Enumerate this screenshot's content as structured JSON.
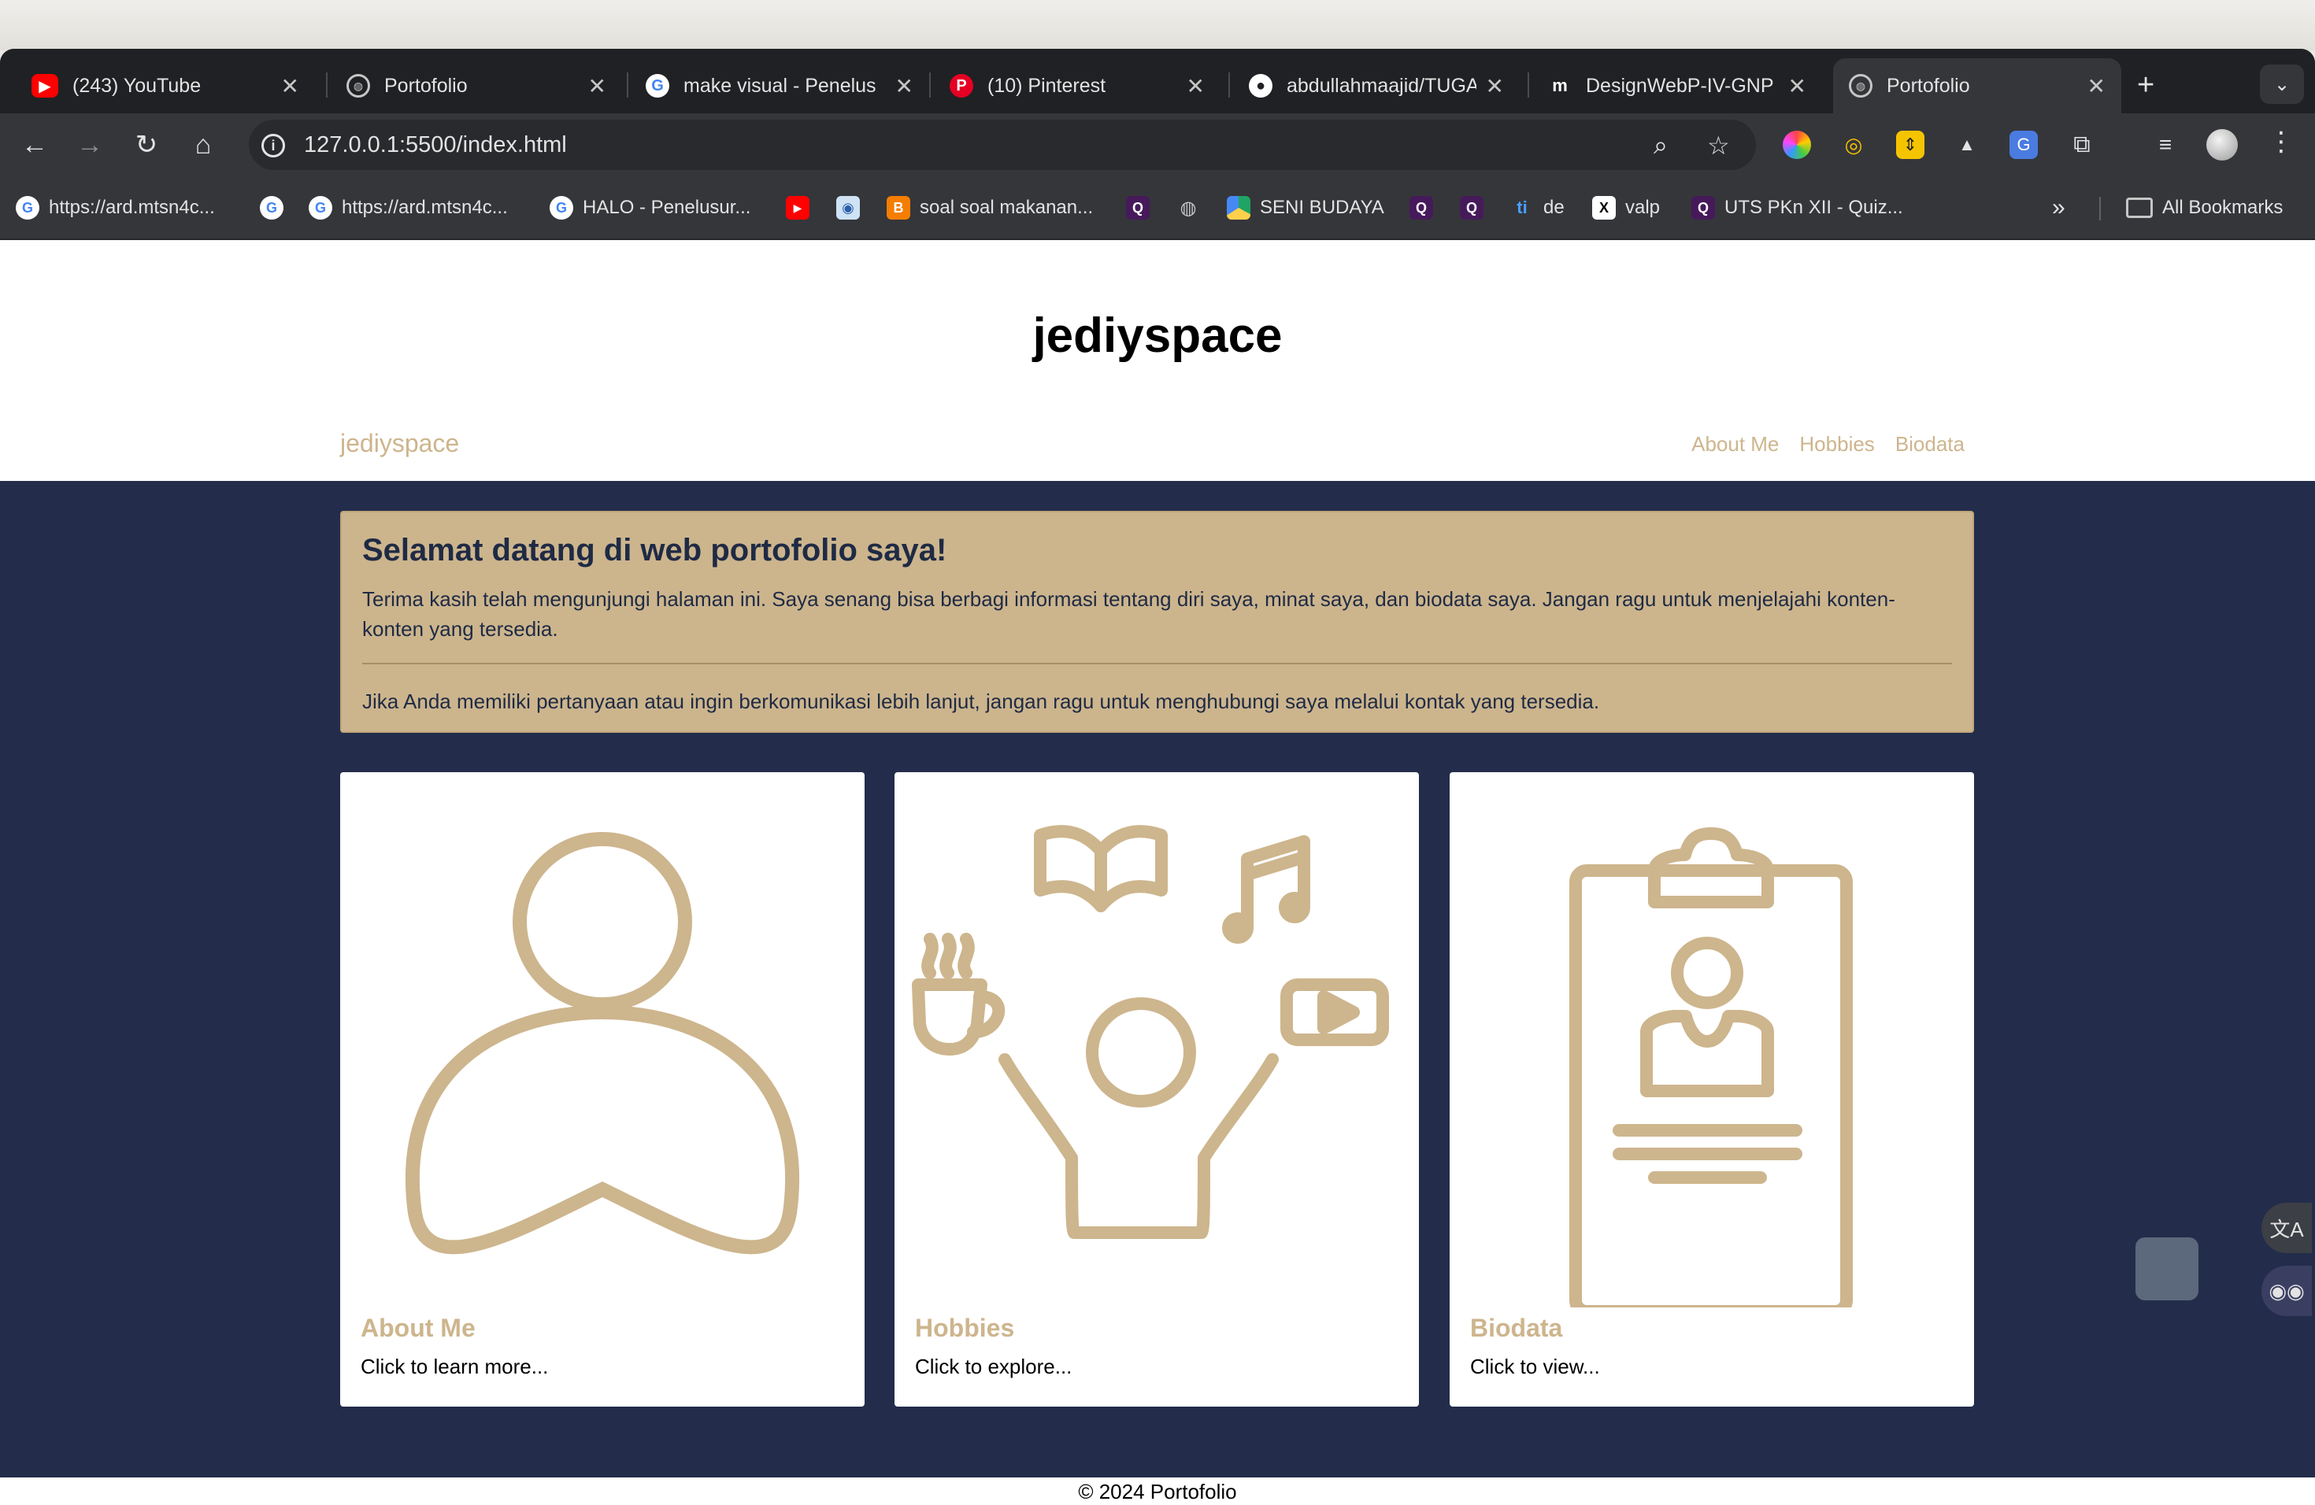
{
  "browser": {
    "tabs": [
      {
        "title": "(243) YouTube",
        "icon": "youtube-icon"
      },
      {
        "title": "Portofolio",
        "icon": "globe-icon"
      },
      {
        "title": "make visual - Penelus",
        "icon": "google-icon"
      },
      {
        "title": "(10) Pinterest",
        "icon": "pinterest-icon"
      },
      {
        "title": "abdullahmaajid/TUGA",
        "icon": "github-icon"
      },
      {
        "title": "DesignWebP-IV-GNP",
        "icon": "medium-icon"
      },
      {
        "title": "Portofolio",
        "icon": "globe-icon",
        "active": true
      }
    ],
    "url": "127.0.0.1:5500/index.html",
    "bookmarks": [
      {
        "label": "https://ard.mtsn4c...",
        "icon": "google-icon"
      },
      {
        "label": "",
        "icon": "google-icon"
      },
      {
        "label": "https://ard.mtsn4c...",
        "icon": "google-icon"
      },
      {
        "label": "HALO - Penelusur...",
        "icon": "google-icon"
      },
      {
        "label": "",
        "icon": "youtube-icon"
      },
      {
        "label": "",
        "icon": "app-icon"
      },
      {
        "label": "soal soal makanan...",
        "icon": "blogger-icon"
      },
      {
        "label": "",
        "icon": "quizizz-icon"
      },
      {
        "label": "",
        "icon": "globe-icon"
      },
      {
        "label": "SENI BUDAYA",
        "icon": "drive-icon"
      },
      {
        "label": "",
        "icon": "quizizz-icon"
      },
      {
        "label": "",
        "icon": "quizizz-icon"
      },
      {
        "label": "de",
        "icon": "ti-icon"
      },
      {
        "label": "valp",
        "icon": "x-icon"
      },
      {
        "label": "UTS PKn XII - Quiz...",
        "icon": "quizizz-icon"
      }
    ],
    "all_bookmarks": "All Bookmarks"
  },
  "site": {
    "title": "jediyspace",
    "brand": "jediyspace",
    "nav": [
      "About Me",
      "Hobbies",
      "Biodata"
    ],
    "accent": "#cdb58d",
    "navy": "#232d4b"
  },
  "jumbotron": {
    "heading": "Selamat datang di web portofolio saya!",
    "p1": "Terima kasih telah mengunjungi halaman ini. Saya senang bisa berbagi informasi tentang diri saya, minat saya, dan biodata saya. Jangan ragu untuk menjelajahi konten-konten yang tersedia.",
    "p2": "Jika Anda memiliki pertanyaan atau ingin berkomunikasi lebih lanjut, jangan ragu untuk menghubungi saya melalui kontak yang tersedia."
  },
  "cards": [
    {
      "title": "About Me",
      "text": "Click to learn more...",
      "icon": "person-icon"
    },
    {
      "title": "Hobbies",
      "text": "Click to explore...",
      "icon": "hobbies-icon"
    },
    {
      "title": "Biodata",
      "text": "Click to view...",
      "icon": "clipboard-id-icon"
    }
  ],
  "footer": "© 2024 Portofolio"
}
